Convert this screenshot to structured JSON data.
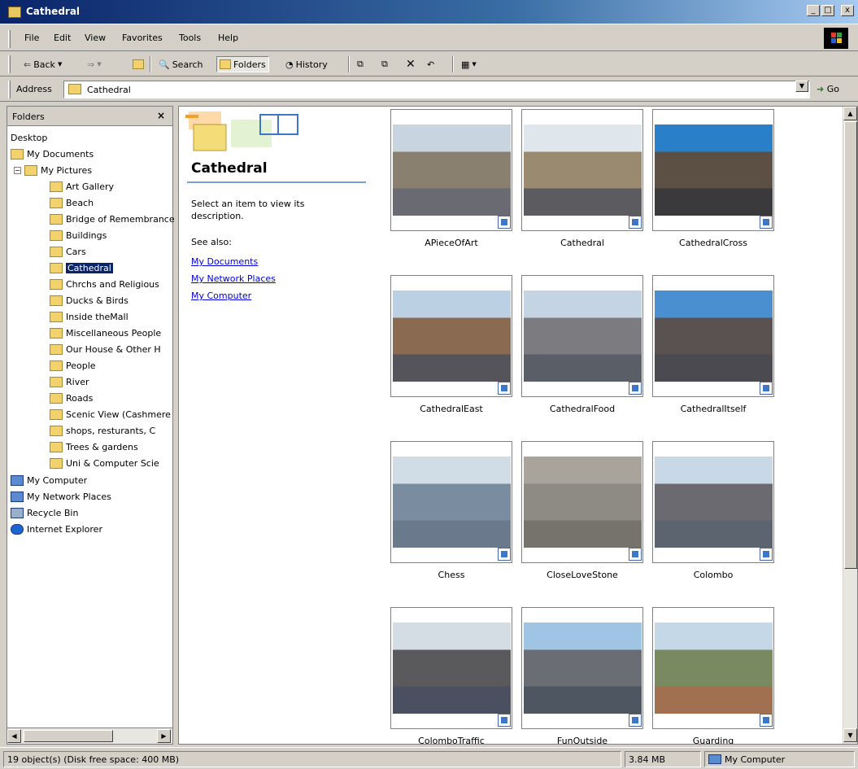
{
  "window": {
    "title": "Cathedral",
    "minimize_glyph": "_",
    "maximize_glyph": "□",
    "close_glyph": "x"
  },
  "menu": [
    "File",
    "Edit",
    "View",
    "Favorites",
    "Tools",
    "Help"
  ],
  "toolbar": {
    "back_label": "Back",
    "forward_glyph": "⇒",
    "search_label": "Search",
    "folders_label": "Folders",
    "history_label": "History"
  },
  "address": {
    "label": "Address",
    "value": "Cathedral",
    "go_label": "Go"
  },
  "folders_pane": {
    "title": "Folders",
    "close_glyph": "×",
    "desktop": "Desktop",
    "my_documents": "My Documents",
    "my_pictures": "My Pictures",
    "subfolders": [
      "Art Gallery",
      "Beach",
      "Bridge of Remembrance",
      "Buildings",
      "Cars",
      "Cathedral",
      "Chrchs and Religious",
      "Ducks & Birds",
      "Inside theMall",
      "Miscellaneous People",
      "Our House & Other H",
      "People",
      "River",
      "Roads",
      "Scenic View (Cashmere",
      "shops, resturants, C",
      "Trees & gardens",
      "Uni & Computer Scie"
    ],
    "selected": "Cathedral",
    "bottom_items": [
      "My Computer",
      "My Network Places",
      "Recycle Bin",
      "Internet Explorer"
    ]
  },
  "info_panel": {
    "title": "Cathedral",
    "description": "Select an item to view its description.",
    "see_also_label": "See also:",
    "links": [
      "My Documents",
      "My Network Places",
      "My Computer"
    ]
  },
  "thumbnails": [
    "APieceOfArt",
    "Cathedral",
    "CathedralCross",
    "CathedralEast",
    "CathedralFood",
    "CathedralItself",
    "Chess",
    "CloseLoveStone",
    "Colombo",
    "ColomboTraffic",
    "FunOutside",
    "Guarding"
  ],
  "status": {
    "objects": "19 object(s) (Disk free space: 400 MB)",
    "size": "3.84 MB",
    "zone": "My Computer"
  },
  "colors": {
    "title_bar": "#0a246a",
    "selection": "#0a246a",
    "link": "#0000e0"
  }
}
